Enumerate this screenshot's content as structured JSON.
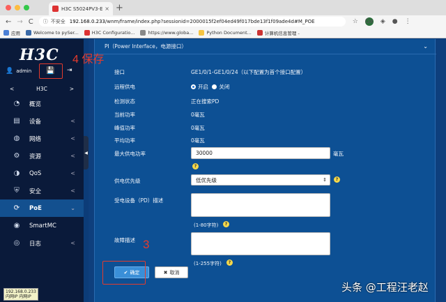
{
  "browser": {
    "tab_title": "H3C S5024PV3-EI-HPWR[PoE]",
    "tab_close": "×",
    "new_tab": "+",
    "insecure_label": "不安全",
    "url_host": "192.168.0.233",
    "url_path": "/wnm/frame/index.php?sessionid=2000015f2ef04ed49f017bde13f1f09ade4d#M_POE",
    "bookmarks": [
      {
        "label": "应用",
        "color": "#4a7fd6"
      },
      {
        "label": "Welcome to pySer...",
        "color": "#3a6aa8"
      },
      {
        "label": "H3C Configuratio...",
        "color": "#d33"
      },
      {
        "label": "https://www.globa...",
        "color": "#888"
      },
      {
        "label": "Python Document...",
        "color": "#f5c342"
      },
      {
        "label": "计算机信息管理 -",
        "color": "#c33"
      }
    ]
  },
  "sidebar": {
    "logo": "H3C",
    "username": "admin",
    "nav_label": "H3C",
    "nav_prev": "<",
    "nav_next": ">",
    "items": [
      {
        "label": "概览",
        "icon": "overview-icon",
        "glyph": "◔",
        "has_arrow": false
      },
      {
        "label": "设备",
        "icon": "device-icon",
        "glyph": "▤",
        "has_arrow": true
      },
      {
        "label": "网络",
        "icon": "network-icon",
        "glyph": "◍",
        "has_arrow": true
      },
      {
        "label": "资源",
        "icon": "resource-icon",
        "glyph": "⚙",
        "has_arrow": true
      },
      {
        "label": "QoS",
        "icon": "qos-icon",
        "glyph": "◑",
        "has_arrow": true
      },
      {
        "label": "安全",
        "icon": "security-icon",
        "glyph": "⛨",
        "has_arrow": true
      },
      {
        "label": "PoE",
        "icon": "poe-icon",
        "glyph": "⟳",
        "has_arrow": true,
        "active": true
      },
      {
        "label": "SmartMC",
        "icon": "smartmc-icon",
        "glyph": "◉",
        "has_arrow": false
      },
      {
        "label": "日志",
        "icon": "log-icon",
        "glyph": "◎",
        "has_arrow": true
      }
    ],
    "ip_badge_line1": "192.168.0.233",
    "ip_badge_line2": "内网IP 内网IP"
  },
  "panel": {
    "header": "PI（Power Interface，电源接口）",
    "interface_label": "接口",
    "interface_value": "GE1/0/1-GE1/0/24（以下配置为首个接口配置）",
    "remote_power_label": "远程供电",
    "remote_power_on": "开启",
    "remote_power_off": "关闭",
    "detect_status_label": "检测状态",
    "detect_status_value": "正在搜索PD",
    "current_power_label": "当前功率",
    "current_power_value": "0毫瓦",
    "peak_power_label": "峰值功率",
    "peak_power_value": "0毫瓦",
    "avg_power_label": "平均功率",
    "avg_power_value": "0毫瓦",
    "max_power_label": "最大供电功率",
    "max_power_value": "30000",
    "max_power_unit": "毫瓦",
    "priority_label": "供电优先级",
    "priority_value": "低优先级",
    "pd_desc_label": "受电设备（PD）描述",
    "pd_desc_hint": "(1-80字符)",
    "fault_desc_label": "故障描述",
    "fault_desc_hint": "(1-255字符)",
    "ok_button": "确定",
    "cancel_button": "取消"
  },
  "annotations": {
    "save_note": "4 保存",
    "step3": "3",
    "watermark": "头条 @工程汪老赵"
  },
  "colors": {
    "sidebar_bg": "#0a1a3a",
    "panel_bg": "#0d5094",
    "active_menu": "#13508f",
    "annotation_red": "#e53b2c",
    "ok_button": "#3a8fd8"
  }
}
